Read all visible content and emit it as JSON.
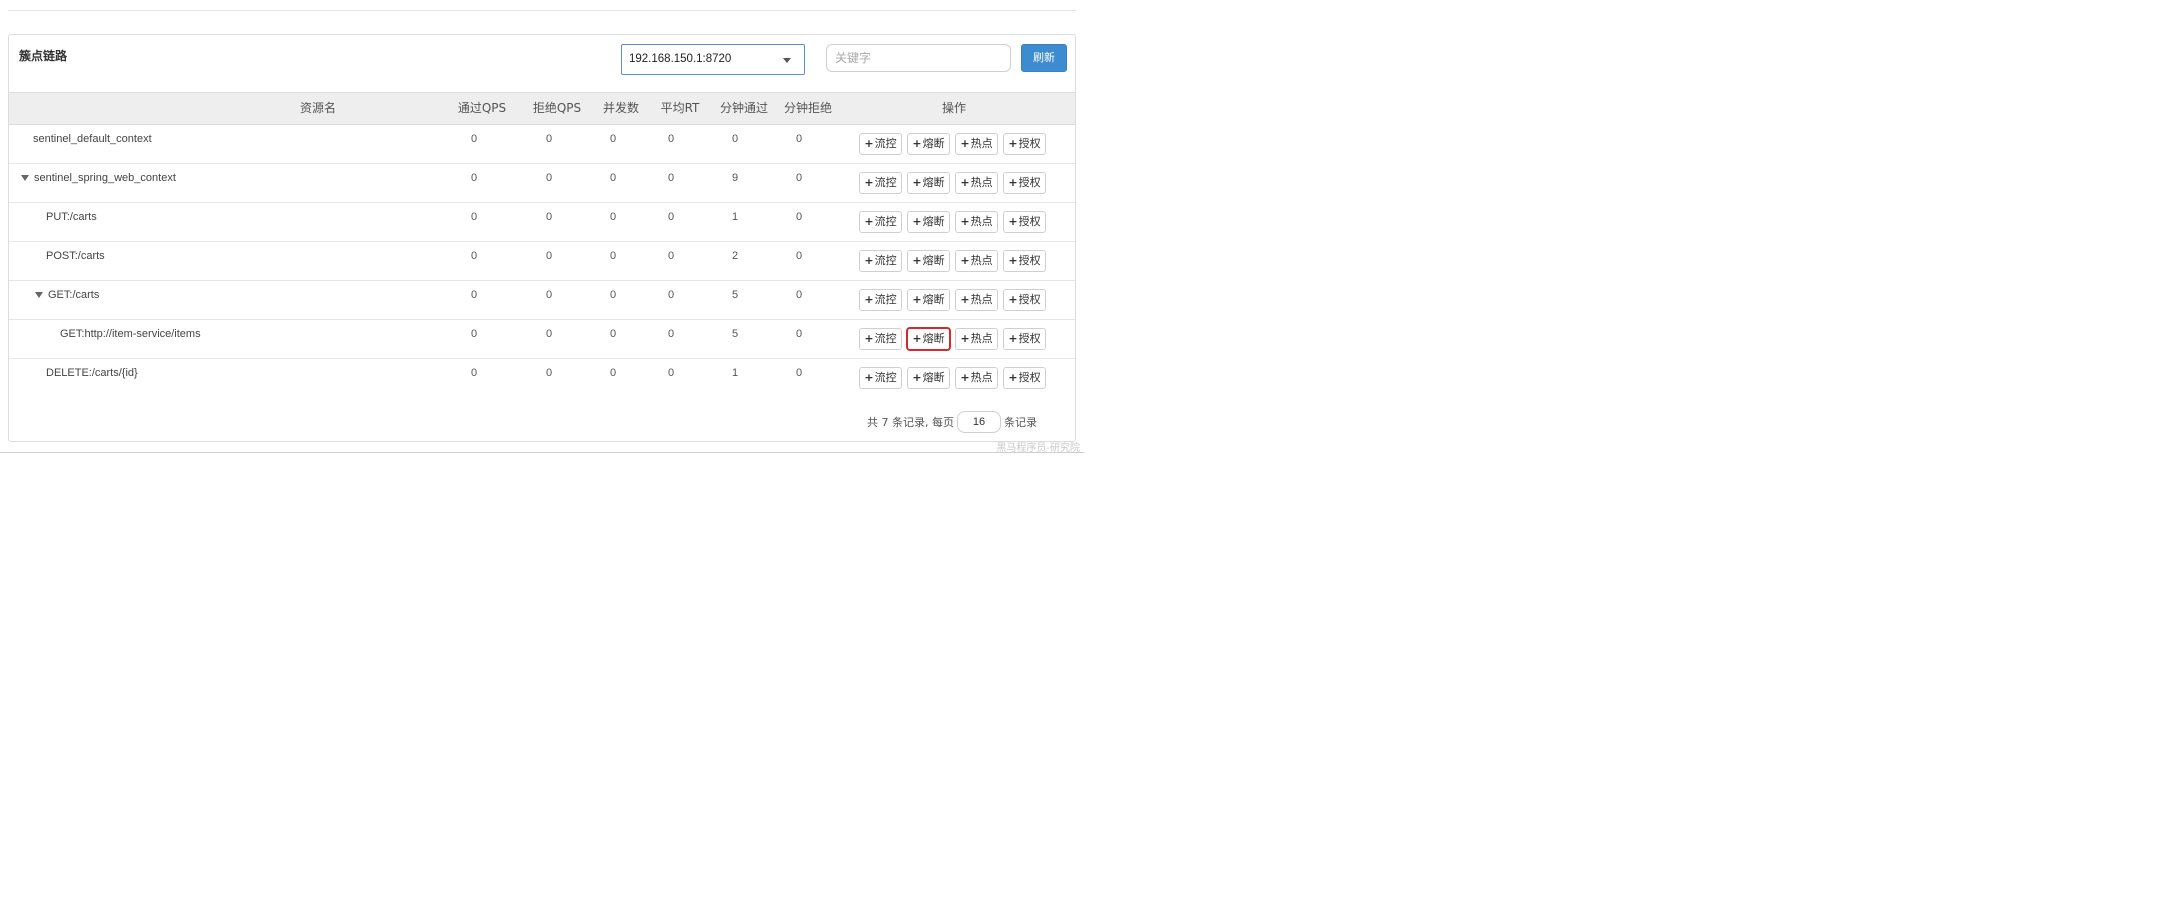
{
  "panel": {
    "title": "簇点链路",
    "machine_select": "192.168.150.1:8720",
    "keyword_placeholder": "关键字",
    "refresh_label": "刷新"
  },
  "table": {
    "headers": {
      "resource": "资源名",
      "pass_qps": "通过QPS",
      "block_qps": "拒绝QPS",
      "concurrency": "并发数",
      "avg_rt": "平均RT",
      "min_pass": "分钟通过",
      "min_block": "分钟拒绝",
      "ops": "操作"
    },
    "op_labels": [
      "流控",
      "熔断",
      "热点",
      "授权"
    ],
    "rows": [
      {
        "name": "sentinel_default_context",
        "expanded": false,
        "values": [
          "0",
          "0",
          "0",
          "0",
          "0",
          "0"
        ]
      },
      {
        "name": "sentinel_spring_web_context",
        "expanded": true,
        "values": [
          "0",
          "0",
          "0",
          "0",
          "9",
          "0"
        ]
      },
      {
        "name": "PUT:/carts",
        "expanded": false,
        "values": [
          "0",
          "0",
          "0",
          "0",
          "1",
          "0"
        ]
      },
      {
        "name": "POST:/carts",
        "expanded": false,
        "values": [
          "0",
          "0",
          "0",
          "0",
          "2",
          "0"
        ]
      },
      {
        "name": "GET:/carts",
        "expanded": true,
        "values": [
          "0",
          "0",
          "0",
          "0",
          "5",
          "0"
        ]
      },
      {
        "name": "GET:http://item-service/items",
        "expanded": false,
        "values": [
          "0",
          "0",
          "0",
          "0",
          "5",
          "0"
        ]
      },
      {
        "name": "DELETE:/carts/{id}",
        "expanded": false,
        "values": [
          "0",
          "0",
          "0",
          "0",
          "1",
          "0"
        ]
      }
    ]
  },
  "pager": {
    "total_text": "共 7 条记录, 每页",
    "page_size": "16",
    "suffix": "条记录"
  },
  "watermark": "黑马程序员-研究院",
  "colors": {
    "primary": "#3d8bd1",
    "highlight": "#d62a2a",
    "header_bg": "#eeeeee"
  }
}
